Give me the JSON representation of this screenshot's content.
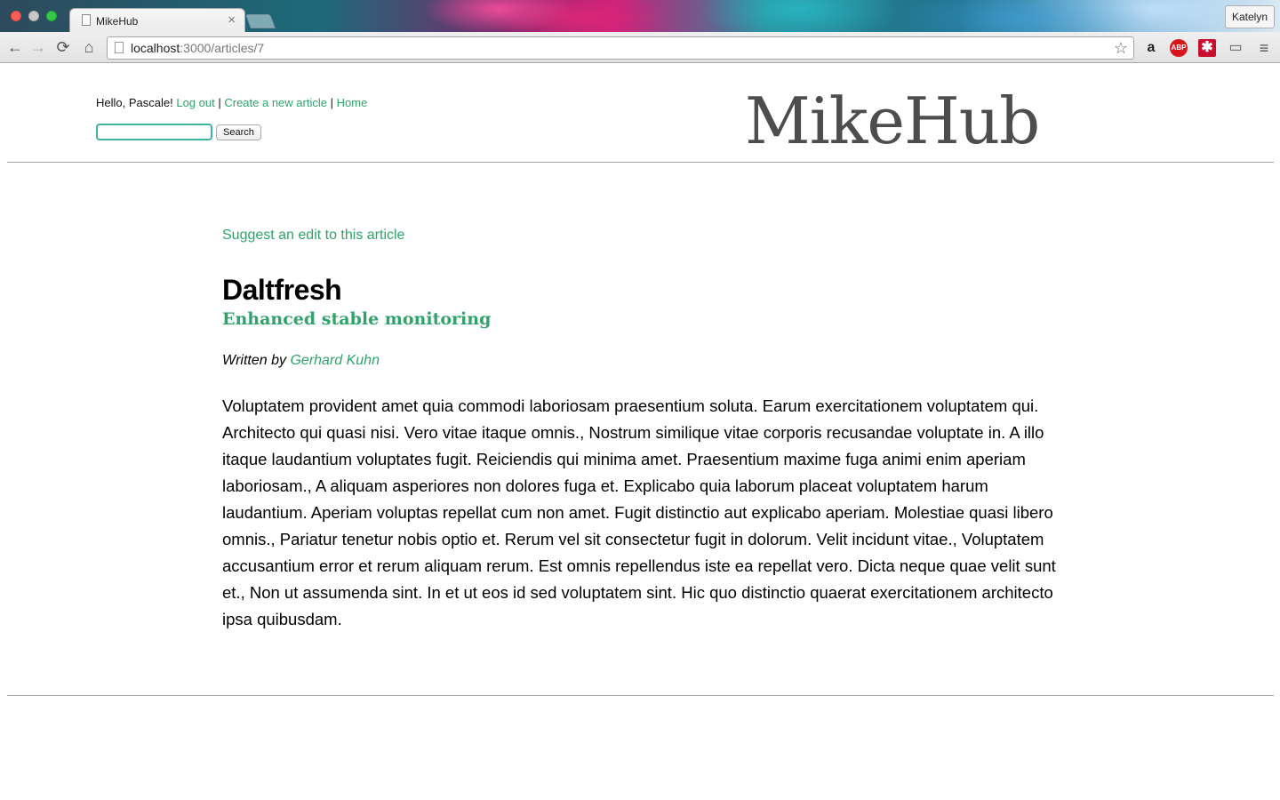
{
  "browser": {
    "tab_title": "MikeHub",
    "tab_close": "×",
    "profile_name": "Katelyn",
    "url_host": "localhost",
    "url_rest": ":3000/articles/7",
    "icons": {
      "back": "←",
      "forward": "→",
      "reload": "⟳",
      "home": "⌂",
      "star": "☆",
      "amazon": "a",
      "abp": "ABP",
      "lastpass": "✱",
      "cast": "▭",
      "menu": "≡"
    }
  },
  "header": {
    "greeting": "Hello, Pascale!",
    "logout": "Log out",
    "separator": "|",
    "create_article": "Create a new article",
    "home": "Home",
    "search_value": "",
    "search_button": "Search",
    "brand": "MikeHub"
  },
  "article": {
    "suggest_edit": "Suggest an edit to this article",
    "title": "Daltfresh",
    "subtitle": "Enhanced stable monitoring",
    "written_by": "Written by",
    "author": "Gerhard Kuhn",
    "body": "Voluptatem provident amet quia commodi laboriosam praesentium soluta. Earum exercitationem voluptatem qui. Architecto qui quasi nisi. Vero vitae itaque omnis., Nostrum similique vitae corporis recusandae voluptate in. A illo itaque laudantium voluptates fugit. Reiciendis qui minima amet. Praesentium maxime fuga animi enim aperiam laboriosam., A aliquam asperiores non dolores fuga et. Explicabo quia laborum placeat voluptatem harum laudantium. Aperiam voluptas repellat cum non amet. Fugit distinctio aut explicabo aperiam. Molestiae quasi libero omnis., Pariatur tenetur nobis optio et. Rerum vel sit consectetur fugit in dolorum. Velit incidunt vitae., Voluptatem accusantium error et rerum aliquam rerum. Est omnis repellendus iste ea repellat vero. Dicta neque quae velit sunt et., Non ut assumenda sint. In et ut eos id sed voluptatem sint. Hic quo distinctio quaerat exercitationem architecto ipsa quibusdam."
  },
  "colors": {
    "link": "#2fa36b",
    "brand": "#4d4d4d",
    "search_focus": "#3bb5a0"
  }
}
